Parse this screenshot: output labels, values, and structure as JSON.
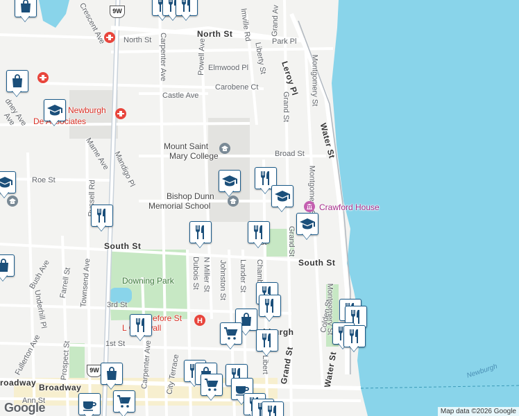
{
  "map": {
    "attribution": "Map data ©2026 Google",
    "logo": "Google",
    "colors": {
      "water": "#89d4ea",
      "land": "#f3f3f1",
      "park": "#c7e8c4",
      "marker_border": "#1b5b8a",
      "marker_icon": "#1b4f7a",
      "hospital": "#e8453c",
      "museum": "#c45fb0"
    }
  },
  "roads": {
    "north_st": "North St",
    "north_st_west": "North St",
    "south_st": "South St",
    "south_st_east": "South St",
    "broadway": "Broadway",
    "broadway_west": "roadway",
    "water_st": "Water St",
    "water_st_south": "Water St",
    "leroy_pl": "Leroy Pl",
    "grand_st_n": "Grand St",
    "grand_st_mid": "Grand St",
    "grand_st_s": "Grand St",
    "grand_av": "Grand Av",
    "montgomery_st_n": "Montgomery St",
    "montgomery_st_mid": "Montgomery St",
    "montgomery_st_s": "Montgomery St",
    "liberty_st": "Liberty St",
    "liberty_st_s": "Libert",
    "powell_ave": "Powell Ave",
    "carpenter_ave_n": "Carpenter Ave",
    "carpenter_ave_s": "Carpenter Ave",
    "crescent_ave": "Crescent Ave",
    "elmwood_pl": "Elmwood Pl",
    "carobene_ct": "Carobene Ct",
    "castle_ave": "Castle Ave",
    "park_pl": "Park Pl",
    "broad_st": "Broad St",
    "roe_st": "Roe St",
    "mame_ave": "Mame Ave",
    "mandigo_pl": "Mandigo Pl",
    "russell_rd": "Russell Rd",
    "townsend_ave": "Townsend Ave",
    "bush_ave": "Bush Ave",
    "farrell_st": "Farrell St",
    "underhill_pl": "Underhill Pl",
    "fullerton_ave": "Fullerton Ave",
    "prospect_st": "Prospect St",
    "dubois_st": "Dubois St",
    "n_miller_st": "N Miller St",
    "johnston_st": "Johnston St",
    "lander_st": "Lander St",
    "chambers_st": "Chambers St",
    "third_st": "3rd St",
    "first_st": "1st St",
    "colden_st": "Colden St",
    "city_terrace": "City Terrace",
    "ann_st": "Ann St",
    "almville_rd": "lmville Rd",
    "dney_ave": "dney Ave",
    "ave_fragment": "Ave",
    "st_fragment": "St",
    "beefore_st": "efore St",
    "ahburgh": "ahburgh",
    "route_9w": "9W"
  },
  "places": {
    "mount_saint_mary_1": "Mount Saint",
    "mount_saint_mary_2": "Mary College",
    "bishop_dunn_1": "Bishop Dunn",
    "bishop_dunn_2": "Memorial School",
    "crawford_house": "Crawford House",
    "downing_park": "Downing Park",
    "newburgh_dental_1": "Newburgh",
    "newburgh_dental_2": "De    Associates",
    "cornwall": "L         Cornwall",
    "newburgh_water": "Newburgh"
  }
}
